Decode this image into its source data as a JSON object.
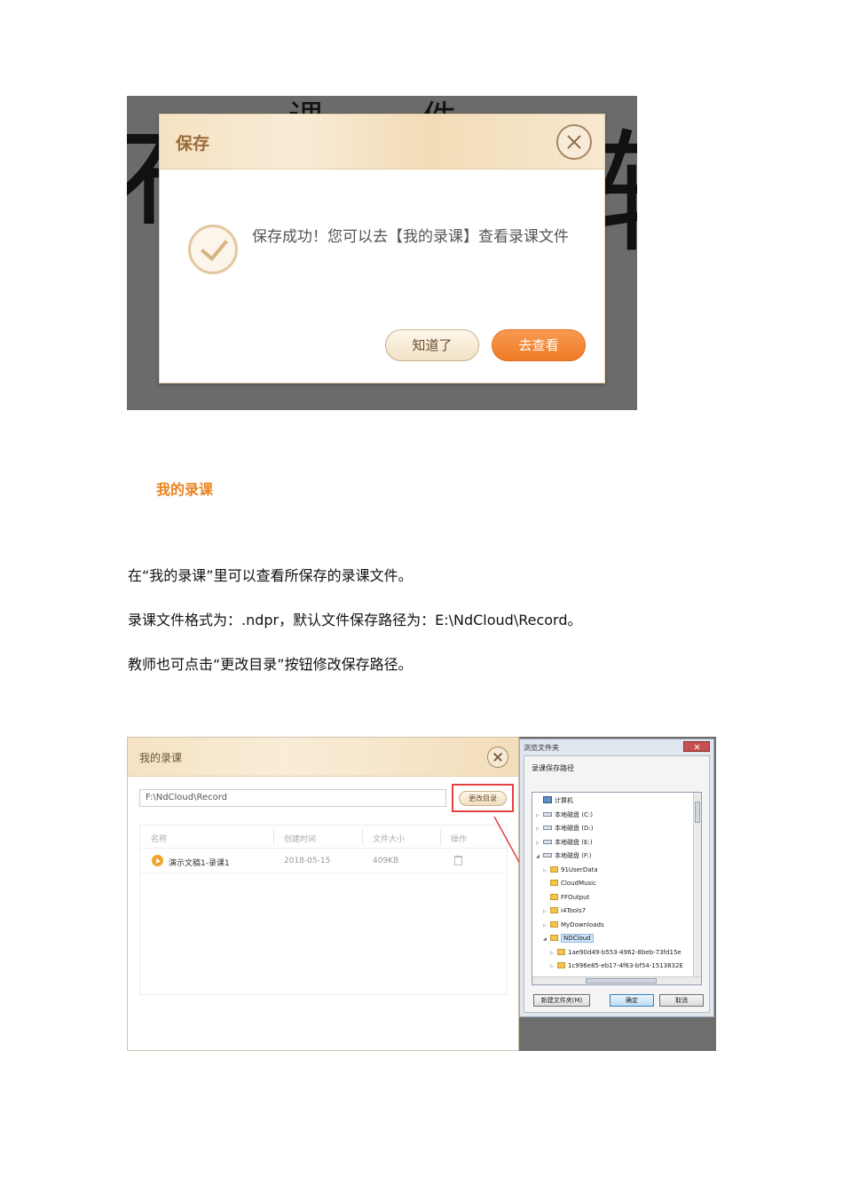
{
  "figure1": {
    "background_glyphs": [
      "布",
      "软",
      "课",
      "件"
    ],
    "dialog": {
      "title": "保存",
      "message": "保存成功！您可以去【我的录课】查看录课文件",
      "buttons": {
        "know": "知道了",
        "go": "去查看"
      }
    }
  },
  "section": {
    "heading": "我的录课",
    "paragraphs": [
      "在“我的录课”里可以查看所保存的录课文件。",
      "录课文件格式为：.ndpr，默认文件保存路径为：E:\\NdCloud\\Record。",
      "教师也可点击“更改目录”按钮修改保存路径。"
    ]
  },
  "figure2": {
    "record_window": {
      "title": "我的录课",
      "path": "F:\\NdCloud\\Record",
      "change_dir_button": "更改目录",
      "columns": [
        "名称",
        "创建时间",
        "文件大小",
        "操作"
      ],
      "rows": [
        {
          "name": "演示文稿1-录课1",
          "created": "2018-05-15",
          "size": "409KB"
        }
      ]
    },
    "browse_dialog": {
      "title": "浏览文件夹",
      "label": "录课保存路径",
      "tree": [
        {
          "label": "计算机",
          "icon": "pc-icon",
          "level": 0,
          "arrow": ""
        },
        {
          "label": "本地磁盘 (C:)",
          "icon": "drive-icon",
          "level": 0,
          "arrow": "▷"
        },
        {
          "label": "本地磁盘 (D:)",
          "icon": "drive-icon",
          "level": 0,
          "arrow": "▷"
        },
        {
          "label": "本地磁盘 (E:)",
          "icon": "drive-icon",
          "level": 0,
          "arrow": "▷"
        },
        {
          "label": "本地磁盘 (F:)",
          "icon": "drive-icon",
          "level": 0,
          "arrow": "◢"
        },
        {
          "label": "91UserData",
          "icon": "folder-icon",
          "level": 1,
          "arrow": "▷"
        },
        {
          "label": "CloudMusic",
          "icon": "folder-icon",
          "level": 1,
          "arrow": ""
        },
        {
          "label": "FFOutput",
          "icon": "folder-icon",
          "level": 1,
          "arrow": ""
        },
        {
          "label": "i4Tools7",
          "icon": "folder-icon",
          "level": 1,
          "arrow": "▷"
        },
        {
          "label": "MyDownloads",
          "icon": "folder-icon",
          "level": 1,
          "arrow": "▷"
        },
        {
          "label": "NDCloud",
          "icon": "folder-icon",
          "level": 1,
          "arrow": "◢",
          "selected": true
        },
        {
          "label": "1ae90d49-b553-4962-8beb-73fd15e",
          "icon": "folder-icon",
          "level": 2,
          "arrow": "▷"
        },
        {
          "label": "1c996e85-eb17-4f63-bf54-1513832E",
          "icon": "folder-icon",
          "level": 2,
          "arrow": "▷"
        }
      ],
      "buttons": {
        "new_folder": "新建文件夹(M)",
        "ok": "确定",
        "cancel": "取消"
      }
    }
  },
  "colors": {
    "accent": "#e8821c",
    "highlight_box": "#e53f3f",
    "go_button": "#ef7a26"
  }
}
